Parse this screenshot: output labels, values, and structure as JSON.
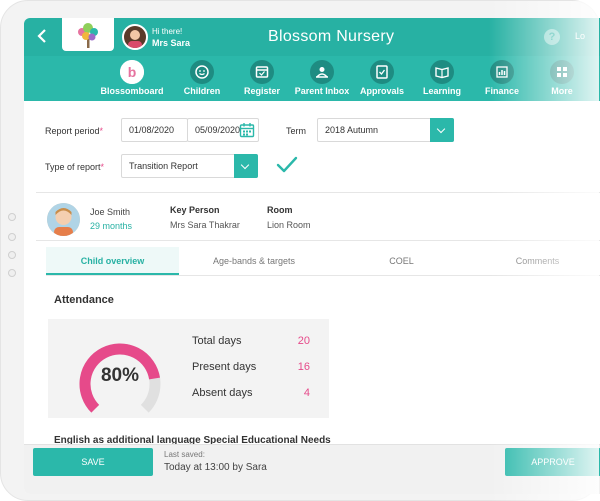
{
  "header": {
    "back_icon": "chevron-left-icon",
    "greeting": "Hi there!",
    "user_name": "Mrs Sara",
    "app_title": "Blossom Nursery",
    "help_label": "?",
    "logout_label": "Lo"
  },
  "nav": {
    "items": [
      {
        "label": "Blossomboard",
        "icon": "blossom-logo-icon"
      },
      {
        "label": "Children",
        "icon": "smiley-icon"
      },
      {
        "label": "Register",
        "icon": "register-icon"
      },
      {
        "label": "Parent Inbox",
        "icon": "parent-inbox-icon"
      },
      {
        "label": "Approvals",
        "icon": "approvals-icon"
      },
      {
        "label": "Learning",
        "icon": "book-icon"
      },
      {
        "label": "Finance",
        "icon": "finance-chart-icon"
      },
      {
        "label": "More",
        "icon": "grid-icon"
      }
    ]
  },
  "filters": {
    "report_period_label": "Report period",
    "date_from": "01/08/2020",
    "date_to": "05/09/2020",
    "term_label": "Term",
    "term_value": "2018 Autumn",
    "report_type_label": "Type of report",
    "report_type_value": "Transition Report",
    "required_mark": "*"
  },
  "child": {
    "name": "Joe Smith",
    "age": "29 months",
    "key_person_label": "Key Person",
    "key_person": "Mrs Sara Thakrar",
    "room_label": "Room",
    "room": "Lion Room"
  },
  "tabs": [
    "Child overview",
    "Age-bands & targets",
    "COEL",
    "Comments"
  ],
  "attendance": {
    "title": "Attendance",
    "percent": 80,
    "percent_label": "80%",
    "total_label": "Total days",
    "total": "20",
    "present_label": "Present days",
    "present": "16",
    "absent_label": "Absent days",
    "absent": "4"
  },
  "next_section_text": "English as additional language     Special Educational Needs",
  "footer": {
    "save_label": "SAVE",
    "last_saved_label": "Last saved:",
    "last_saved_value": "Today at 13:00 by Sara",
    "approve_label": "APPROVE"
  },
  "colors": {
    "brand": "#2bb8aa",
    "accent": "#e64a8a"
  }
}
